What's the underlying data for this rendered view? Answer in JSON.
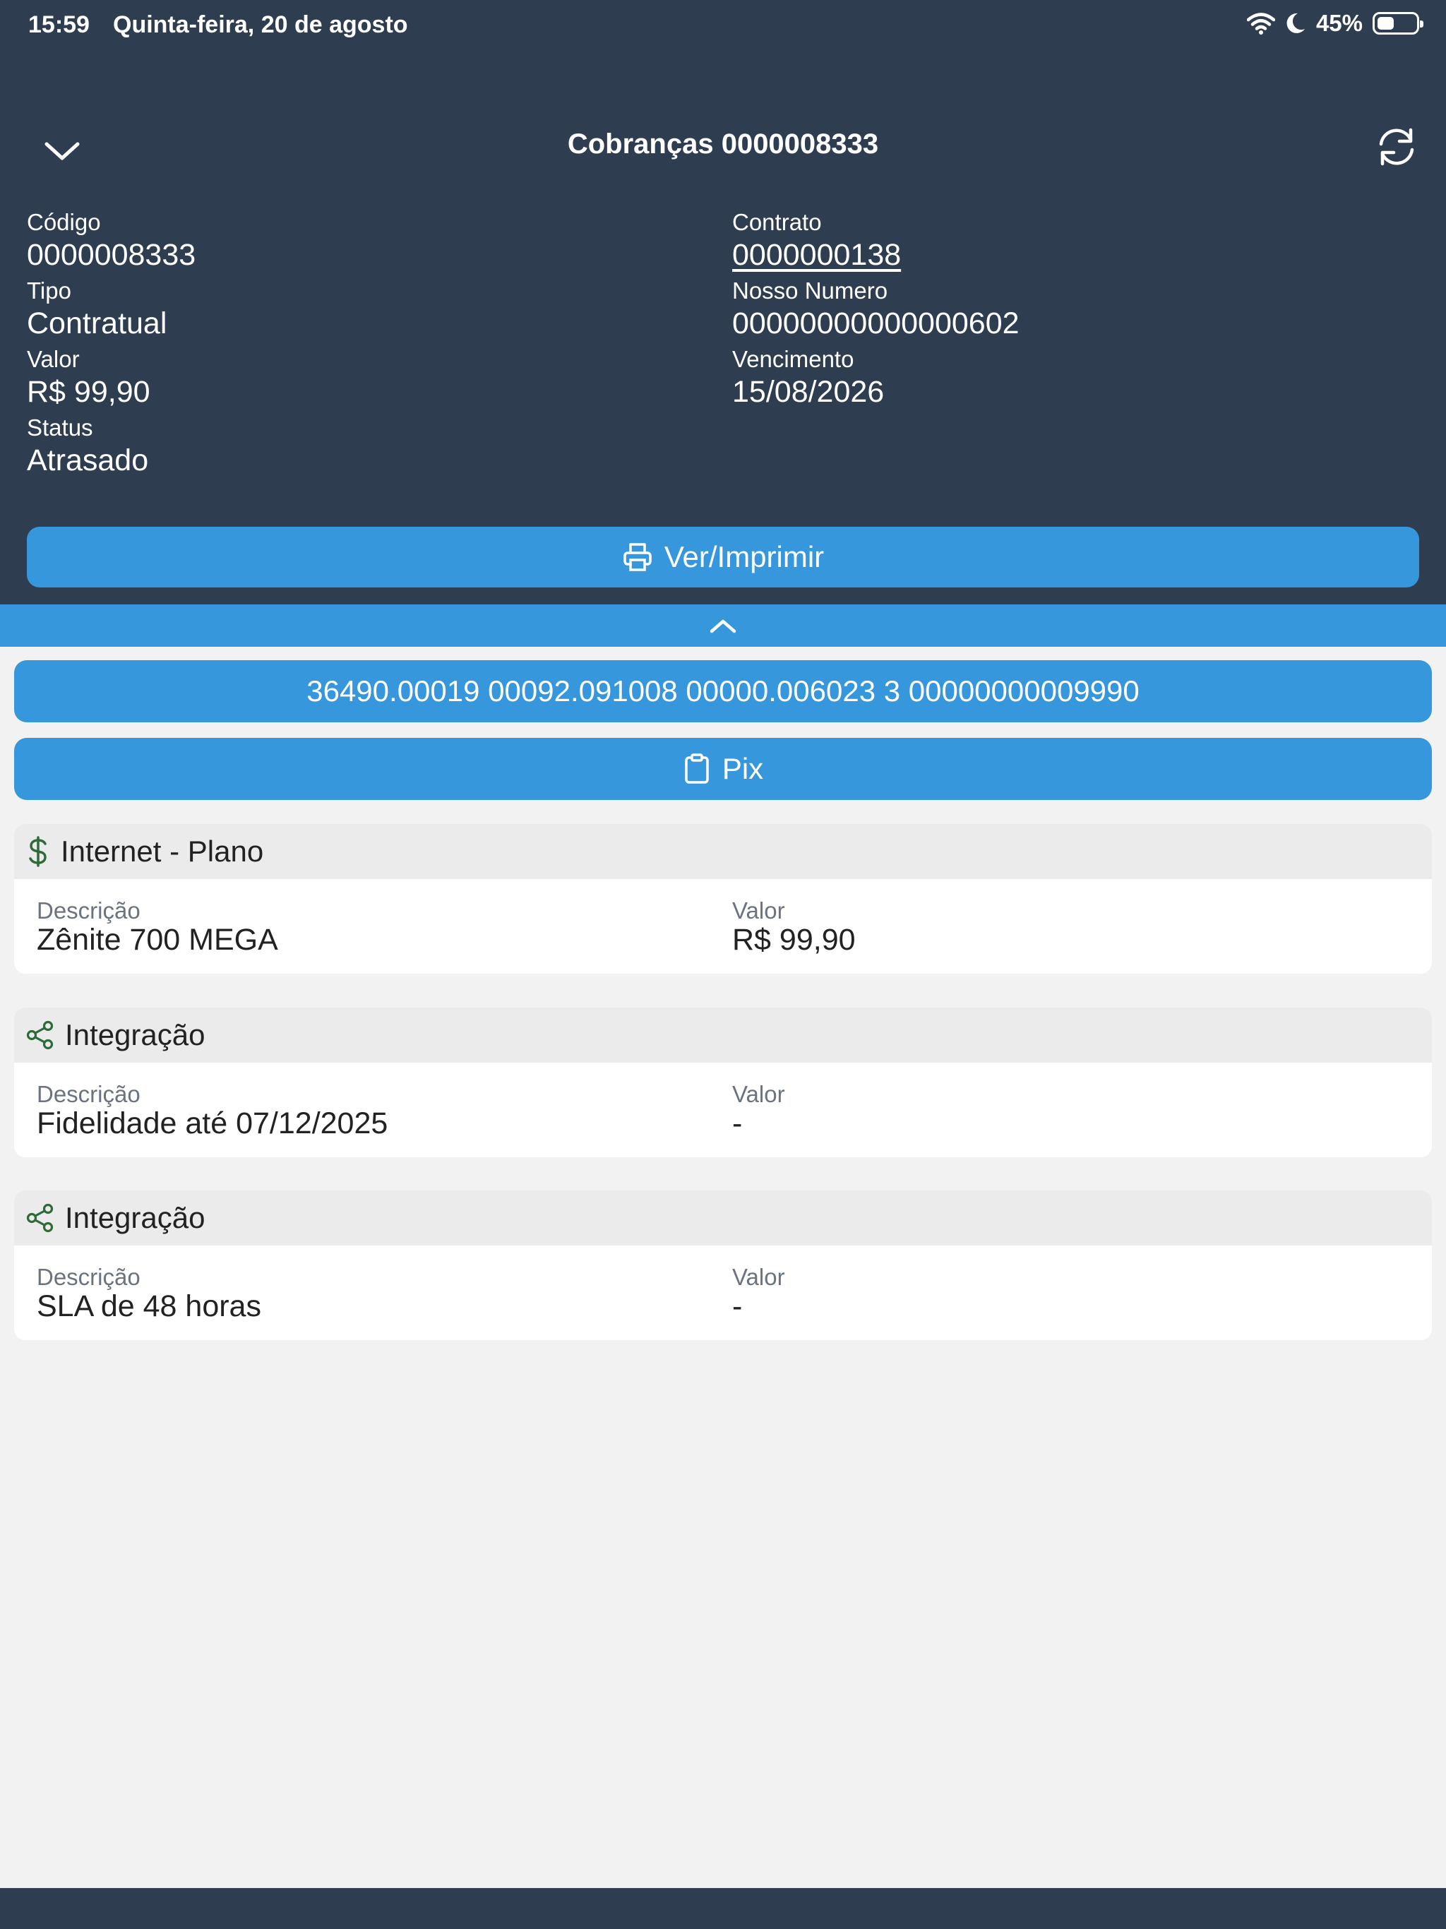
{
  "status_bar": {
    "time": "15:59",
    "date": "Quinta-feira, 20 de agosto",
    "battery_percent_label": "45%",
    "battery_level": 0.45
  },
  "nav": {
    "title": "Cobranças 0000008333",
    "collapse_icon": "chevron-down-icon",
    "refresh_icon": "refresh-icon"
  },
  "details": {
    "codigo_label": "Código",
    "codigo_value": "0000008333",
    "tipo_label": "Tipo",
    "tipo_value": "Contratual",
    "valor_label": "Valor",
    "valor_value": "R$ 99,90",
    "status_label": "Status",
    "status_value": "Atrasado",
    "contrato_label": "Contrato",
    "contrato_value": "0000000138",
    "nosso_numero_label": "Nosso Numero",
    "nosso_numero_value": "00000000000000602",
    "vencimento_label": "Vencimento",
    "vencimento_value": "15/08/2026"
  },
  "actions": {
    "print_label": "Ver/Imprimir",
    "barcode_label": "36490.00019 00092.091008 00000.006023 3 00000000009990",
    "pix_label": "Pix"
  },
  "cards": [
    {
      "title": "Internet - Plano",
      "icon": "dollar-icon",
      "descricao_label": "Descrição",
      "descricao_value": "Zênite 700 MEGA",
      "valor_label": "Valor",
      "valor_value": "R$ 99,90"
    },
    {
      "title": "Integração",
      "icon": "share-icon",
      "descricao_label": "Descrição",
      "descricao_value": "Fidelidade até 07/12/2025",
      "valor_label": "Valor",
      "valor_value": "-"
    },
    {
      "title": "Integração",
      "icon": "share-icon",
      "descricao_label": "Descrição",
      "descricao_value": "SLA de 48 horas",
      "valor_label": "Valor",
      "valor_value": "-"
    }
  ],
  "colors": {
    "header_bg": "#2e3d50",
    "accent_blue": "#3697dc",
    "icon_green": "#2f6b3a",
    "page_bg": "#f2f2f2"
  }
}
